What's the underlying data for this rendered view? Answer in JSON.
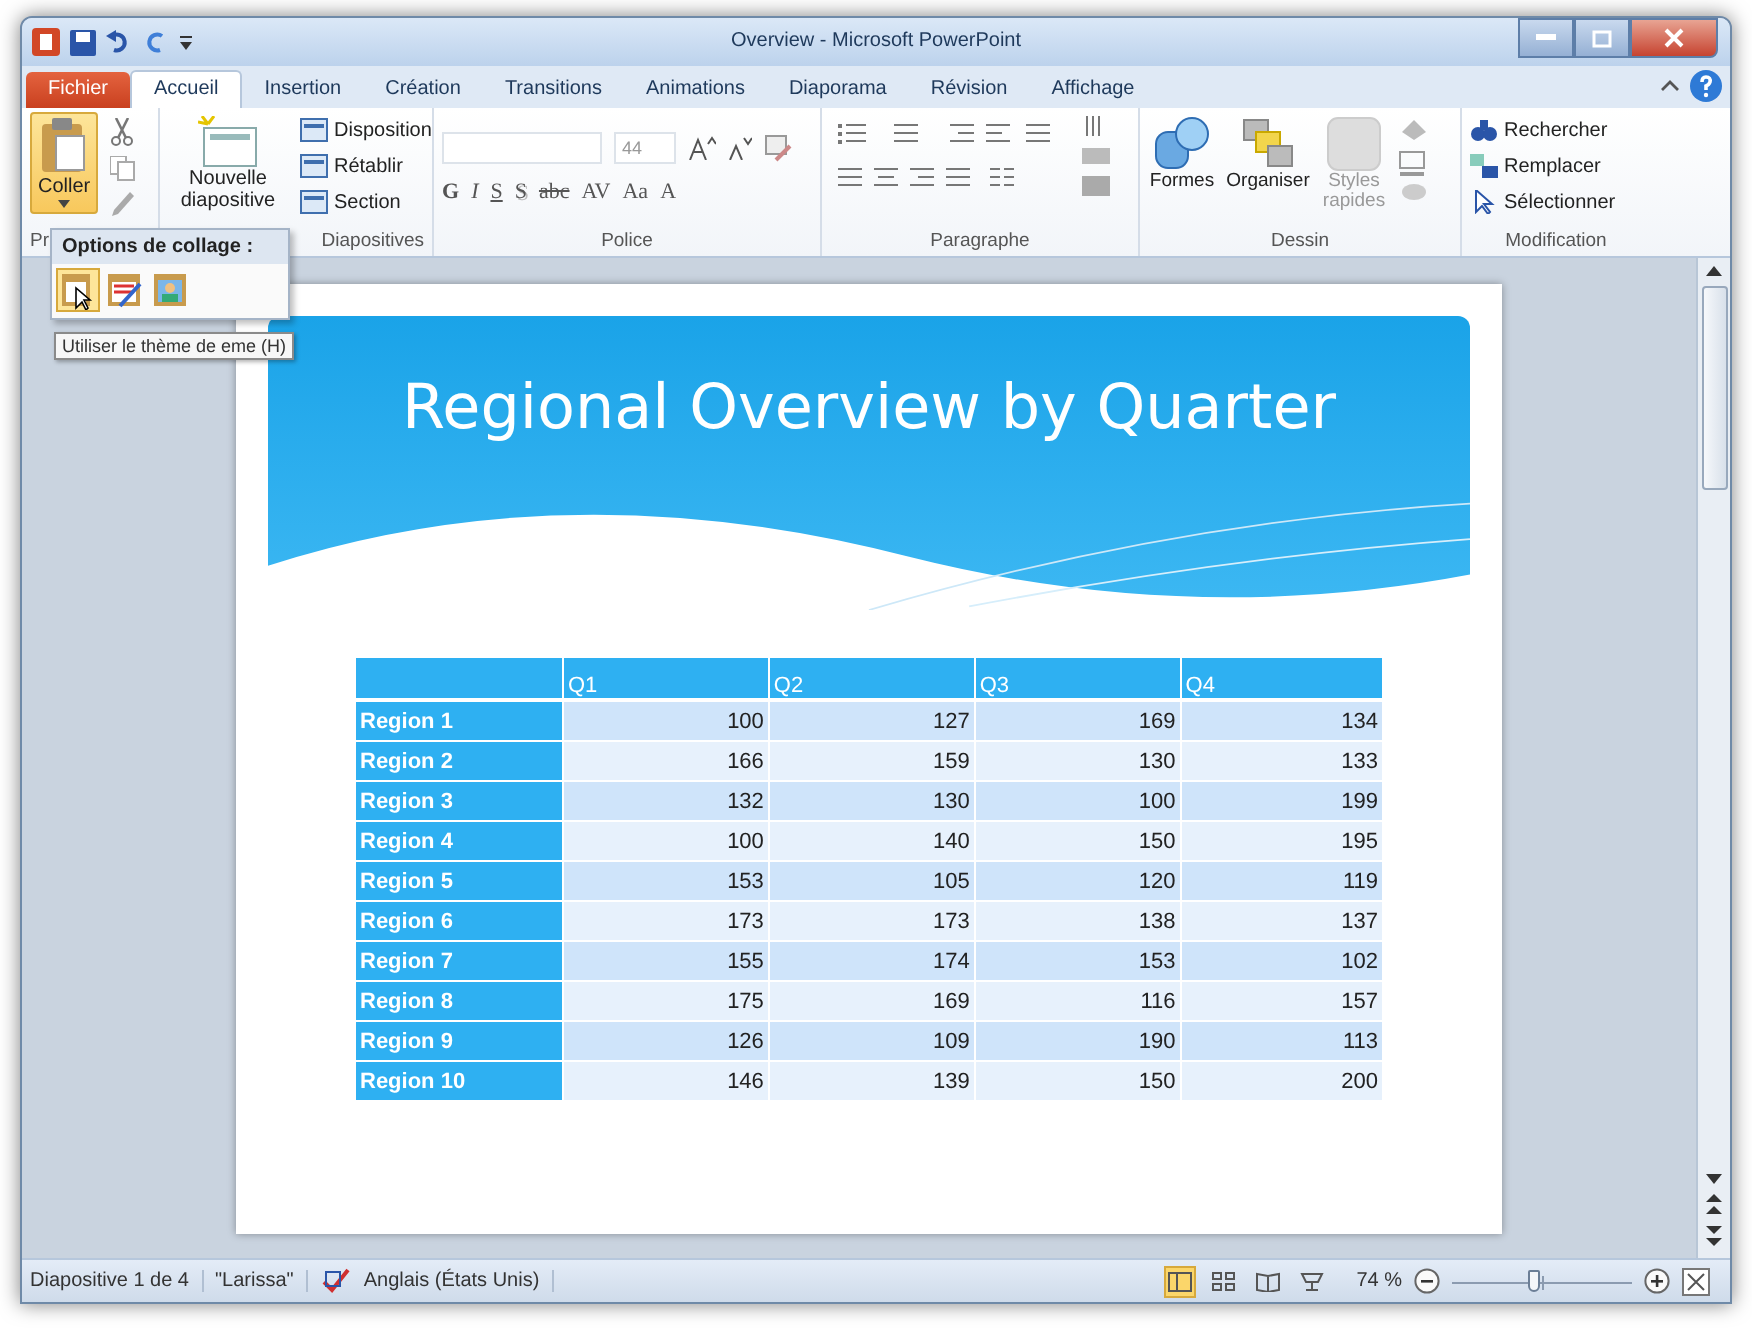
{
  "window": {
    "title": "Overview - Microsoft PowerPoint"
  },
  "tabs": [
    {
      "label": "Fichier",
      "kind": "file",
      "selected": false
    },
    {
      "label": "Accueil",
      "kind": "tab",
      "selected": true
    },
    {
      "label": "Insertion",
      "kind": "tab",
      "selected": false
    },
    {
      "label": "Création",
      "kind": "tab",
      "selected": false
    },
    {
      "label": "Transitions",
      "kind": "tab",
      "selected": false
    },
    {
      "label": "Animations",
      "kind": "tab",
      "selected": false
    },
    {
      "label": "Diaporama",
      "kind": "tab",
      "selected": false
    },
    {
      "label": "Révision",
      "kind": "tab",
      "selected": false
    },
    {
      "label": "Affichage",
      "kind": "tab",
      "selected": false
    }
  ],
  "clipboard": {
    "label": "Pr",
    "paste": "Coller"
  },
  "slides_group": {
    "label": "Diapositives",
    "new_slide": "Nouvelle diapositive",
    "items": [
      "Disposition",
      "Rétablir",
      "Section"
    ]
  },
  "font_group": {
    "label": "Police",
    "size": "44",
    "format_buttons": [
      {
        "text": "G",
        "kind": "bold"
      },
      {
        "text": "I",
        "kind": "italic"
      },
      {
        "text": "S",
        "kind": "underline"
      },
      {
        "text": "S",
        "kind": "shadow"
      },
      {
        "text": "abc",
        "kind": "strike"
      },
      {
        "text": "AV",
        "kind": "plain"
      },
      {
        "text": "Aa",
        "kind": "plain"
      },
      {
        "text": "A",
        "kind": "plain"
      }
    ]
  },
  "paragraph_group": {
    "label": "Paragraphe"
  },
  "drawing_group": {
    "label": "Dessin",
    "buttons": [
      "Formes",
      "Organiser",
      "Styles rapides"
    ]
  },
  "editing_group": {
    "label": "Modification",
    "items": [
      "Rechercher",
      "Remplacer",
      "Sélectionner"
    ]
  },
  "paste_menu": {
    "heading": "Options de collage :"
  },
  "tooltip": "Utiliser le thème de eme (H)",
  "slide": {
    "title": "Regional Overview by Quarter",
    "table": {
      "columns": [
        "Q1",
        "Q2",
        "Q3",
        "Q4"
      ],
      "rows": [
        {
          "label": "Region 1",
          "cells": [
            "100",
            "127",
            "169",
            "134"
          ]
        },
        {
          "label": "Region 2",
          "cells": [
            "166",
            "159",
            "130",
            "133"
          ]
        },
        {
          "label": "Region 3",
          "cells": [
            "132",
            "130",
            "100",
            "199"
          ]
        },
        {
          "label": "Region 4",
          "cells": [
            "100",
            "140",
            "150",
            "195"
          ]
        },
        {
          "label": "Region 5",
          "cells": [
            "153",
            "105",
            "120",
            "119"
          ]
        },
        {
          "label": "Region 6",
          "cells": [
            "173",
            "173",
            "138",
            "137"
          ]
        },
        {
          "label": "Region 7",
          "cells": [
            "155",
            "174",
            "153",
            "102"
          ]
        },
        {
          "label": "Region 8",
          "cells": [
            "175",
            "169",
            "116",
            "157"
          ]
        },
        {
          "label": "Region 9",
          "cells": [
            "126",
            "109",
            "190",
            "113"
          ]
        },
        {
          "label": "Region 10",
          "cells": [
            "146",
            "139",
            "150",
            "200"
          ]
        }
      ]
    }
  },
  "status_bar": {
    "slide": "Diapositive 1 de 4",
    "theme": "\"Larissa\"",
    "language": "Anglais (États Unis)",
    "views": [
      {
        "kind": "normal",
        "selected": true
      },
      {
        "kind": "sorter",
        "selected": false
      },
      {
        "kind": "reading",
        "selected": false
      },
      {
        "kind": "show",
        "selected": false
      }
    ],
    "zoom": "74 %",
    "zoom_slider": {
      "level": 0.45
    }
  }
}
